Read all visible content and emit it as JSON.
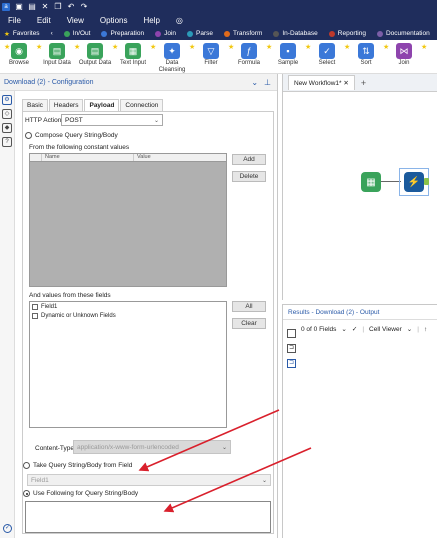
{
  "titlebar": {
    "icons": [
      "app",
      "save",
      "save-as",
      "close",
      "copy",
      "undo",
      "redo"
    ]
  },
  "menu": {
    "items": [
      "File",
      "Edit",
      "View",
      "Options",
      "Help"
    ]
  },
  "tabs": {
    "favorites": "Favorites",
    "categories": [
      {
        "label": "In/Out",
        "color": "#3aa35b"
      },
      {
        "label": "Preparation",
        "color": "#3b78d8"
      },
      {
        "label": "Join",
        "color": "#8e44ad"
      },
      {
        "label": "Parse",
        "color": "#2b9ab8"
      },
      {
        "label": "Transform",
        "color": "#e06a1b"
      },
      {
        "label": "In-Database",
        "color": "#555555"
      },
      {
        "label": "Reporting",
        "color": "#c0392b"
      },
      {
        "label": "Documentation",
        "color": "#7b5ea7"
      }
    ]
  },
  "toolbar": {
    "tools": [
      {
        "label": "Browse",
        "color": "#3aa35b",
        "glyph": "◉"
      },
      {
        "label": "Input Data",
        "color": "#3aa35b",
        "glyph": "▤"
      },
      {
        "label": "Output Data",
        "color": "#3aa35b",
        "glyph": "▤"
      },
      {
        "label": "Text Input",
        "color": "#3aa35b",
        "glyph": "▦"
      },
      {
        "label": "Data Cleansing",
        "color": "#3b78d8",
        "glyph": "✦"
      },
      {
        "label": "Filter",
        "color": "#3b78d8",
        "glyph": "▽"
      },
      {
        "label": "Formula",
        "color": "#3b78d8",
        "glyph": "ƒ"
      },
      {
        "label": "Sample",
        "color": "#3b78d8",
        "glyph": "▪"
      },
      {
        "label": "Select",
        "color": "#3b78d8",
        "glyph": "✓"
      },
      {
        "label": "Sort",
        "color": "#3b78d8",
        "glyph": "⇅"
      },
      {
        "label": "Join",
        "color": "#8e44ad",
        "glyph": "⋈"
      }
    ]
  },
  "config": {
    "header": "Download (2) - Configuration",
    "tabs": [
      "Basic",
      "Headers",
      "Payload",
      "Connection"
    ],
    "active_tab": "Payload",
    "http_action_label": "HTTP Action",
    "http_action_value": "POST",
    "compose_label": "Compose Query String/Body",
    "constant_values_label": "From the following constant values",
    "col_name": "Name",
    "col_value": "Value",
    "add": "Add",
    "delete": "Delete",
    "field_values_label": "And values from these fields",
    "fields": [
      "Field1",
      "Dynamic or Unknown Fields"
    ],
    "all": "All",
    "clear": "Clear",
    "content_type_label": "Content-Type",
    "content_type_value": "application/x-www-form-urlencoded",
    "take_from_field_label": "Take Query String/Body from Field",
    "take_from_field_value": "Field1",
    "use_following_label": "Use Following for Query String/Body"
  },
  "canvas": {
    "tab_label": "New Workflow1*",
    "add_tab": "+"
  },
  "results": {
    "header": "Results - Download (2) - Output",
    "fields_count": "0 of 0 Fields",
    "cell_viewer": "Cell Viewer"
  },
  "annotations": {
    "arrow_color": "#d9202c"
  }
}
